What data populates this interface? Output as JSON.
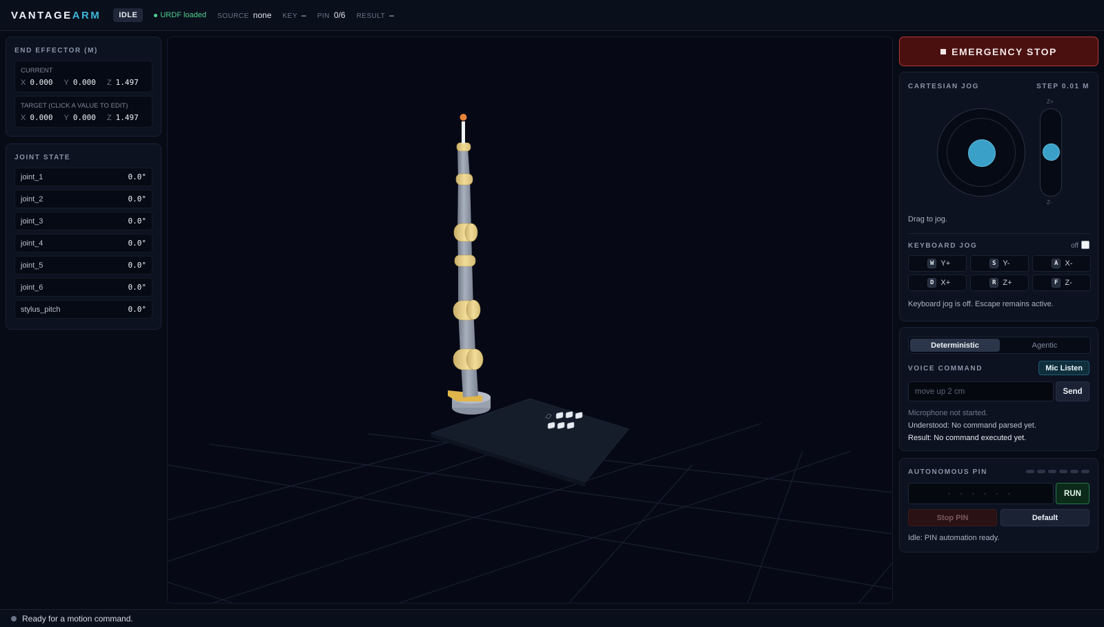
{
  "app": {
    "logo_main": "VANTAGE",
    "logo_accent": "ARM",
    "state": "IDLE",
    "urdf_status": "URDF loaded"
  },
  "meta": [
    {
      "key": "SOURCE",
      "value": "none"
    },
    {
      "key": "KEY",
      "value": "–"
    },
    {
      "key": "PIN",
      "value": "0/6"
    },
    {
      "key": "RESULT",
      "value": "–"
    }
  ],
  "end_effector": {
    "title": "END EFFECTOR (M)",
    "current": {
      "label": "CURRENT",
      "x": "0.000",
      "y": "0.000",
      "z": "1.497"
    },
    "target": {
      "label": "TARGET (CLICK A VALUE TO EDIT)",
      "x": "0.000",
      "y": "0.000",
      "z": "1.497"
    },
    "axes": {
      "x": "X",
      "y": "Y",
      "z": "Z"
    }
  },
  "joint_state": {
    "title": "JOINT STATE",
    "joints": [
      {
        "name": "joint_1",
        "value": "0.0°"
      },
      {
        "name": "joint_2",
        "value": "0.0°"
      },
      {
        "name": "joint_3",
        "value": "0.0°"
      },
      {
        "name": "joint_4",
        "value": "0.0°"
      },
      {
        "name": "joint_5",
        "value": "0.0°"
      },
      {
        "name": "joint_6",
        "value": "0.0°"
      },
      {
        "name": "stylus_pitch",
        "value": "0.0°"
      }
    ]
  },
  "emergency_stop": {
    "label": "EMERGENCY STOP",
    "icon": "stop-square-icon"
  },
  "cartesian_jog": {
    "title": "CARTESIAN JOG",
    "step": "STEP 0.01 M",
    "z_plus": "Z+",
    "z_minus": "Z-",
    "hint": "Drag to jog."
  },
  "keyboard_jog": {
    "title": "KEYBOARD JOG",
    "toggle_label": "off",
    "keys": [
      {
        "key": "W",
        "action": "Y+"
      },
      {
        "key": "S",
        "action": "Y-"
      },
      {
        "key": "A",
        "action": "X-"
      },
      {
        "key": "D",
        "action": "X+"
      },
      {
        "key": "R",
        "action": "Z+"
      },
      {
        "key": "F",
        "action": "Z-"
      }
    ],
    "note": "Keyboard jog is off. Escape remains active."
  },
  "voice": {
    "modes": [
      "Deterministic",
      "Agentic"
    ],
    "active_mode": "Deterministic",
    "title": "VOICE COMMAND",
    "mic_label": "Mic Listen",
    "input_placeholder": "move up 2 cm",
    "input_value": "",
    "send_label": "Send",
    "mic_status": "Microphone not started.",
    "understood": "Understood: No command parsed yet.",
    "result": "Result: No command executed yet."
  },
  "pin": {
    "title": "AUTONOMOUS PIN",
    "input_placeholder": "· · · · · ·",
    "run_label": "RUN",
    "stop_label": "Stop PIN",
    "default_label": "Default",
    "status": "Idle: PIN automation ready.",
    "progress": {
      "done": 0,
      "total": 6
    }
  },
  "statusbar": {
    "text": "Ready for a motion command."
  },
  "colors": {
    "accent": "#3fb6d8",
    "ok": "#4fd08c",
    "danger": "#b53a36",
    "joint_yellow": "#ecd590",
    "link_gray": "#9ea6b4"
  }
}
